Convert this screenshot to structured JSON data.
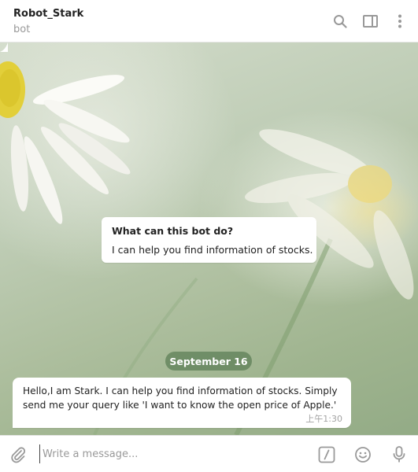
{
  "header": {
    "name": "Robot_Stark",
    "status": "bot"
  },
  "intro": {
    "title": "What can this bot do?",
    "text": "I can help you find information of stocks."
  },
  "date_divider": "September 16",
  "message": {
    "text": "Hello,I am Stark. I can help you find information of stocks. Simply send me your query like 'I want to know the open price of Apple.'",
    "time": "上午1:30"
  },
  "composer": {
    "placeholder": "Write a message...",
    "value": ""
  },
  "icons": {
    "search": "search-icon",
    "sidebar": "sidebar-toggle-icon",
    "more": "more-vertical-icon",
    "attach": "paperclip-icon",
    "commands": "bot-commands-icon",
    "emoji": "emoji-icon",
    "mic": "microphone-icon"
  },
  "colors": {
    "icon": "#999999",
    "date_pill": "#60825a",
    "bubble": "#ffffff"
  }
}
